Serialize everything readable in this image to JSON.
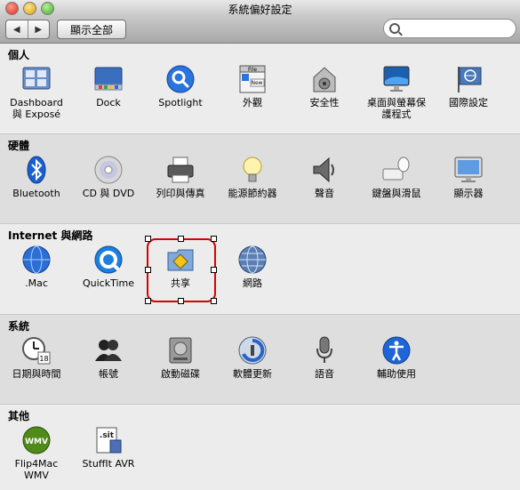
{
  "window": {
    "title": "系統偏好設定"
  },
  "toolbar": {
    "back_glyph": "◀",
    "forward_glyph": "▶",
    "show_all_label": "顯示全部",
    "search_placeholder": "",
    "search_value": ""
  },
  "sections": [
    {
      "title": "個人",
      "items": [
        {
          "label": "Dashboard 與 Exposé",
          "icon": "dashboard-expose-icon"
        },
        {
          "label": "Dock",
          "icon": "dock-icon"
        },
        {
          "label": "Spotlight",
          "icon": "spotlight-icon"
        },
        {
          "label": "外觀",
          "icon": "appearance-icon",
          "badge1": "File",
          "badge2": "New"
        },
        {
          "label": "安全性",
          "icon": "security-icon"
        },
        {
          "label": "桌面與螢幕保護程式",
          "icon": "desktop-screensaver-icon"
        },
        {
          "label": "國際設定",
          "icon": "international-icon"
        }
      ]
    },
    {
      "title": "硬體",
      "items": [
        {
          "label": "Bluetooth",
          "icon": "bluetooth-icon"
        },
        {
          "label": "CD 與 DVD",
          "icon": "cd-dvd-icon"
        },
        {
          "label": "列印與傳真",
          "icon": "printer-icon"
        },
        {
          "label": "能源節約器",
          "icon": "energy-saver-icon"
        },
        {
          "label": "聲音",
          "icon": "sound-icon"
        },
        {
          "label": "鍵盤與滑鼠",
          "icon": "keyboard-mouse-icon"
        },
        {
          "label": "顯示器",
          "icon": "display-icon"
        }
      ]
    },
    {
      "title": "Internet 與網路",
      "items": [
        {
          "label": ".Mac",
          "icon": "dotmac-icon"
        },
        {
          "label": "QuickTime",
          "icon": "quicktime-icon"
        },
        {
          "label": "共享",
          "icon": "sharing-icon"
        },
        {
          "label": "網路",
          "icon": "network-icon"
        }
      ]
    },
    {
      "title": "系統",
      "items": [
        {
          "label": "日期與時間",
          "icon": "date-time-icon",
          "badge1": "18"
        },
        {
          "label": "帳號",
          "icon": "accounts-icon"
        },
        {
          "label": "啟動磁碟",
          "icon": "startup-disk-icon"
        },
        {
          "label": "軟體更新",
          "icon": "software-update-icon"
        },
        {
          "label": "語音",
          "icon": "speech-icon"
        },
        {
          "label": "輔助使用",
          "icon": "universal-access-icon"
        }
      ]
    },
    {
      "title": "其他",
      "items": [
        {
          "label": "Flip4Mac WMV",
          "icon": "flip4mac-icon",
          "badge1": "WMV"
        },
        {
          "label": "StuffIt AVR",
          "icon": "stuffit-icon",
          "badge1": ".sit"
        }
      ]
    }
  ],
  "colors": {
    "selection": "#d90000",
    "accent_blue": "#1d6fd9",
    "section_alt_bg": "#dedede"
  }
}
